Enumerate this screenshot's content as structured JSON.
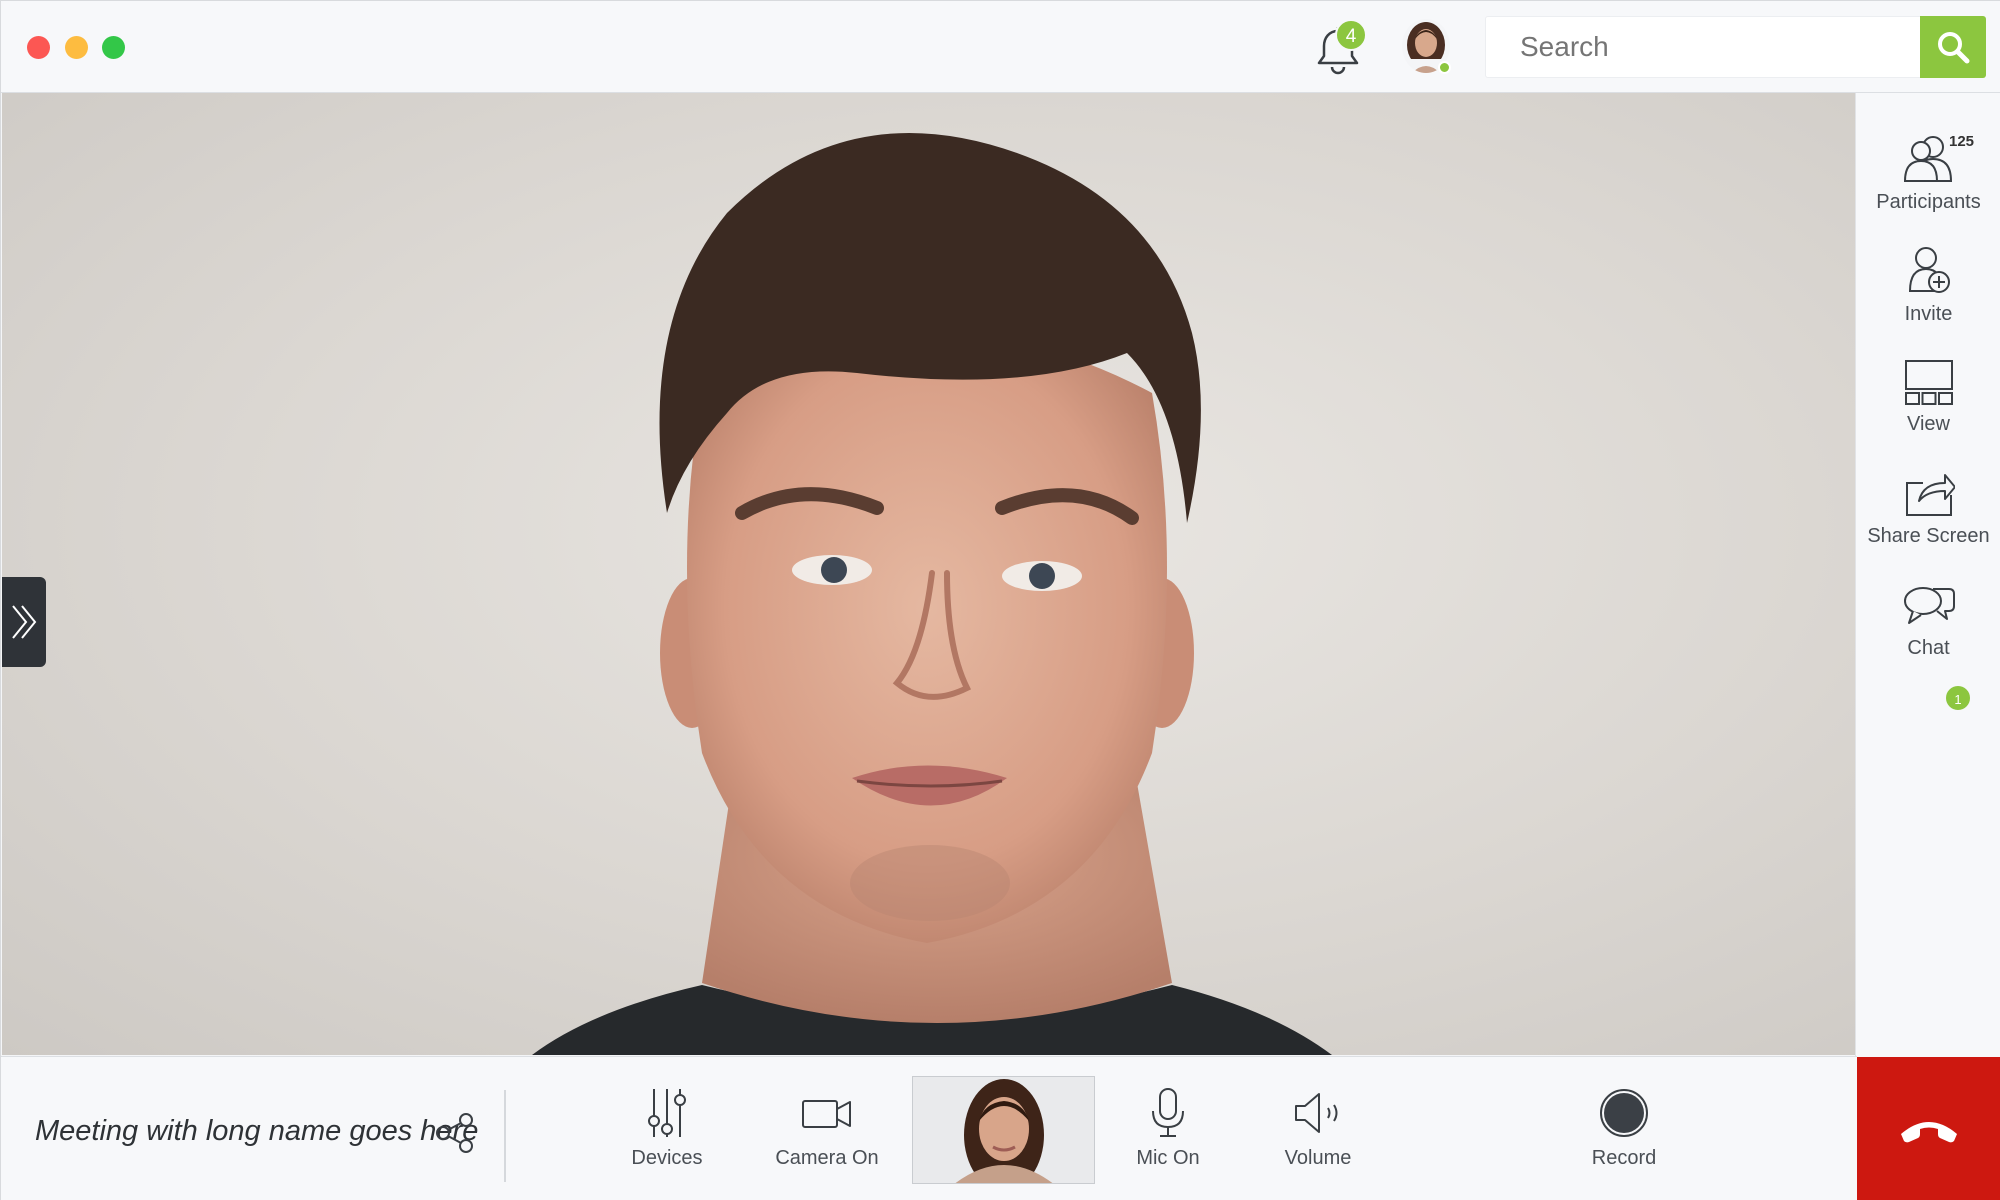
{
  "notifications": {
    "count": "4"
  },
  "search": {
    "placeholder": "Search"
  },
  "sidebar": {
    "items": [
      {
        "label": "Participants",
        "count": "125"
      },
      {
        "label": "Invite"
      },
      {
        "label": "View"
      },
      {
        "label": "Share Screen"
      },
      {
        "label": "Chat",
        "badge": "1"
      }
    ]
  },
  "meeting": {
    "title": "Meeting with long name goes here"
  },
  "controls": {
    "devices": "Devices",
    "camera": "Camera On",
    "mic": "Mic On",
    "volume": "Volume",
    "record": "Record"
  },
  "colors": {
    "accent": "#8cc63f",
    "hangup": "#cd1810",
    "collapse_tab": "#2f3338",
    "traffic_red": "#fc5753",
    "traffic_yellow": "#fdbc40",
    "traffic_green": "#33c748"
  }
}
